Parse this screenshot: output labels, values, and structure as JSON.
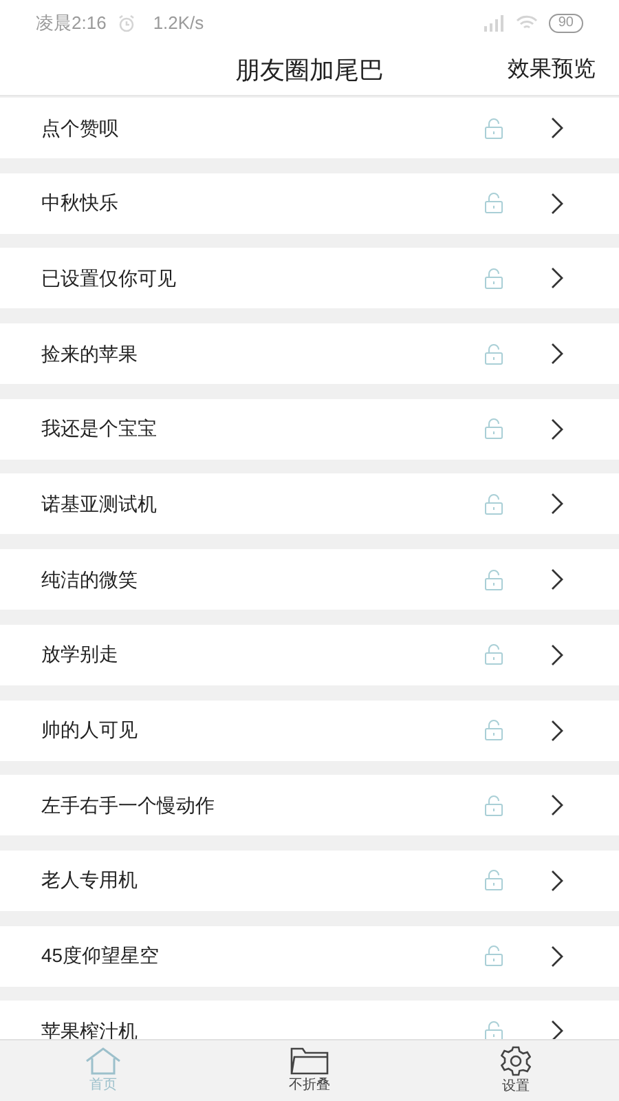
{
  "status_bar": {
    "time": "凌晨2:16",
    "speed": "1.2K/s",
    "battery": "90"
  },
  "header": {
    "title": "朋友圈加尾巴",
    "action": "效果预览"
  },
  "items": [
    {
      "label": "点个赞呗"
    },
    {
      "label": "中秋快乐"
    },
    {
      "label": "已设置仅你可见"
    },
    {
      "label": "捡来的苹果"
    },
    {
      "label": "我还是个宝宝"
    },
    {
      "label": "诺基亚测试机"
    },
    {
      "label": "纯洁的微笑"
    },
    {
      "label": "放学别走"
    },
    {
      "label": "帅的人可见"
    },
    {
      "label": "左手右手一个慢动作"
    },
    {
      "label": "老人专用机"
    },
    {
      "label": "45度仰望星空"
    },
    {
      "label": "苹果榨汁机"
    }
  ],
  "nav": [
    {
      "kind": "home",
      "label": "首页",
      "selected": true
    },
    {
      "kind": "folder",
      "label": "不折叠",
      "selected": false
    },
    {
      "kind": "settings",
      "label": "设置",
      "selected": false
    }
  ]
}
